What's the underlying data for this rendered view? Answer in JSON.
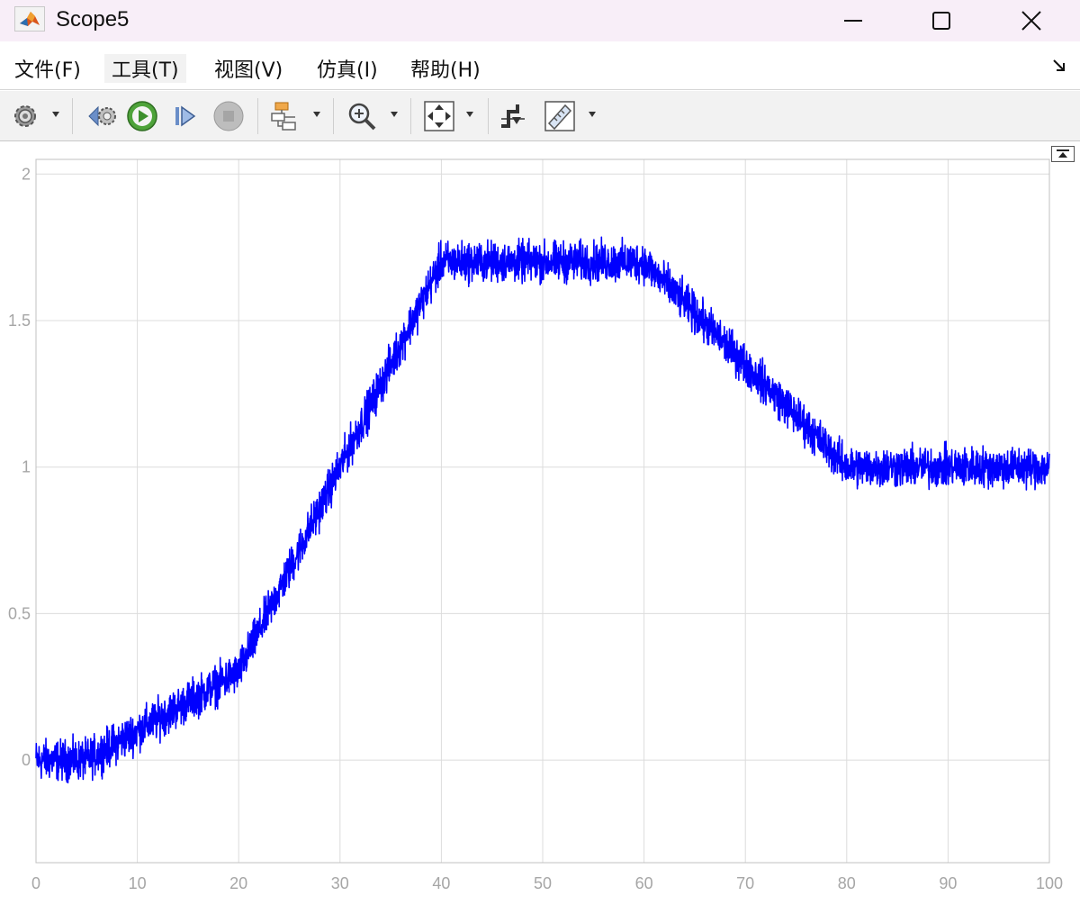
{
  "window": {
    "title": "Scope5",
    "app_icon": "matlab-logo-icon",
    "controls": [
      "minimize-icon",
      "maximize-icon",
      "close-icon"
    ]
  },
  "menu": {
    "items": [
      {
        "label": "文件(F)"
      },
      {
        "label": "工具(T)"
      },
      {
        "label": "视图(V)"
      },
      {
        "label": "仿真(I)"
      },
      {
        "label": "帮助(H)"
      }
    ]
  },
  "toolbar": {
    "icons": [
      "settings-gear-icon",
      "step-back-icon",
      "run-icon",
      "step-forward-icon",
      "stop-icon",
      "highlight-simulink-block-icon",
      "zoom-icon",
      "scale-axes-icon",
      "triggers-icon",
      "measurements-icon"
    ]
  },
  "colors": {
    "signal": "#0000ff",
    "grid": "#dcdcdc",
    "axes_border": "#c0c0c0",
    "tick_text": "#a6a6a6",
    "titlebar_bg": "#f8eef8",
    "toolbar_bg": "#f2f2f2"
  },
  "chart_data": {
    "type": "line",
    "title": "",
    "xlabel": "",
    "ylabel": "",
    "xlim": [
      0,
      100
    ],
    "ylim": [
      -0.35,
      2.05
    ],
    "x_ticks": [
      "0",
      "10",
      "20",
      "30",
      "40",
      "50",
      "60",
      "70",
      "80",
      "90",
      "100"
    ],
    "y_ticks": [
      "0",
      "0.5",
      "1",
      "1.5",
      "2"
    ],
    "grid": true,
    "legend": "none",
    "series": [
      {
        "color": "#0000ff",
        "noise_amplitude": 0.05,
        "trend_points": [
          {
            "x": 0,
            "y": 0.0
          },
          {
            "x": 5,
            "y": 0.0
          },
          {
            "x": 20,
            "y": 0.3
          },
          {
            "x": 40,
            "y": 1.7
          },
          {
            "x": 60,
            "y": 1.7
          },
          {
            "x": 80,
            "y": 1.0
          },
          {
            "x": 100,
            "y": 1.0
          }
        ]
      }
    ]
  }
}
